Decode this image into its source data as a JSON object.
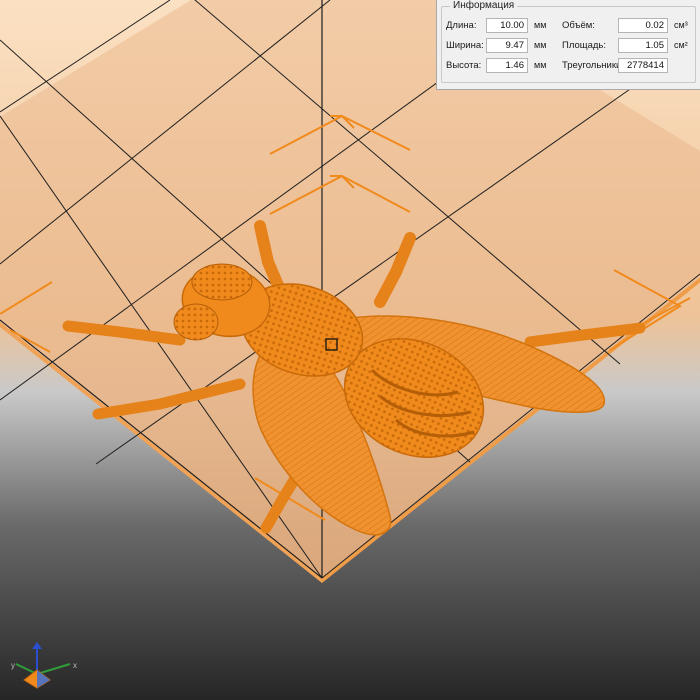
{
  "info_panel": {
    "title": "Информация",
    "length_label": "Длина:",
    "length_value": "10.00",
    "length_unit": "мм",
    "width_label": "Ширина:",
    "width_value": "9.47",
    "width_unit": "мм",
    "height_label": "Высота:",
    "height_value": "1.46",
    "height_unit": "мм",
    "volume_label": "Объём:",
    "volume_value": "0.02",
    "volume_unit": "см³",
    "area_label": "Площадь:",
    "area_value": "1.05",
    "area_unit": "см²",
    "triangles_label": "Треугольники",
    "triangles_value": "2778414"
  },
  "axis_gizmo": {
    "x_label": "x",
    "y_label": "y"
  },
  "colors": {
    "model": "#f08a1c",
    "model_dark": "#c86a0a",
    "platform_top": "#e9b88e",
    "platform_edge": "#f0a257",
    "background_top": "#fadcbb",
    "background_bottom": "#2a2a2a",
    "grid_lines": "#1a1a1a",
    "gizmo_accent": "#f08a1c"
  }
}
